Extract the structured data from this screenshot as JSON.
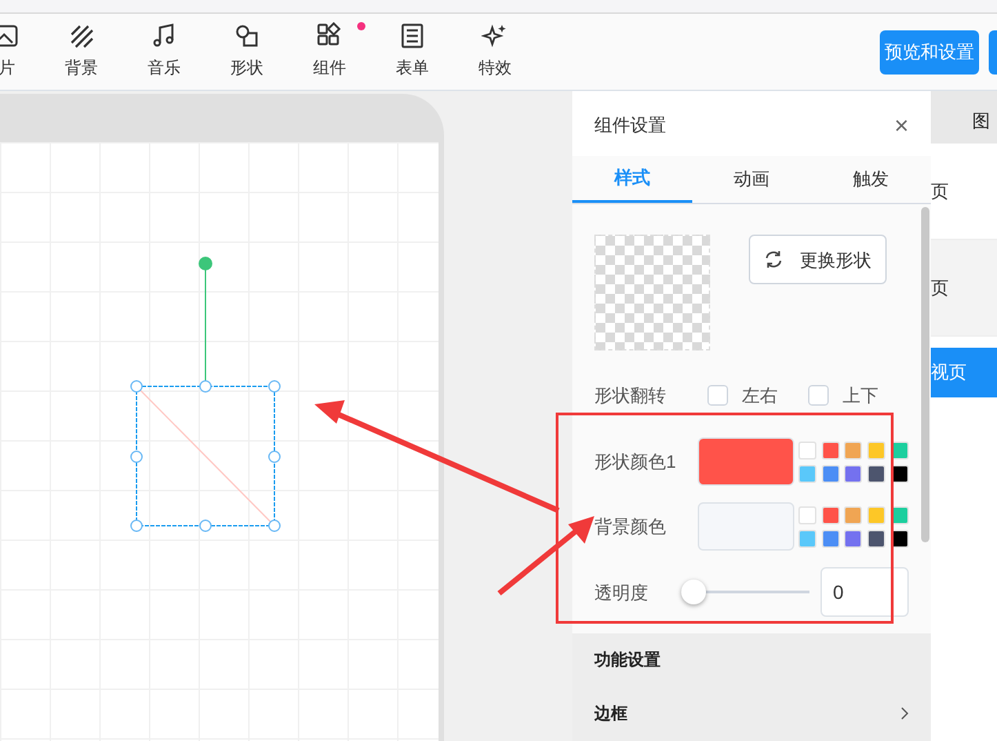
{
  "toolbar": {
    "tools": [
      {
        "label": "片",
        "badge": false
      },
      {
        "label": "背景",
        "badge": false
      },
      {
        "label": "音乐",
        "badge": false
      },
      {
        "label": "形状",
        "badge": false
      },
      {
        "label": "组件",
        "badge": true
      },
      {
        "label": "表单",
        "badge": false
      },
      {
        "label": "特效",
        "badge": false
      }
    ],
    "preview_button": "预览和设置"
  },
  "right_sidebar": {
    "header": "图",
    "items": [
      {
        "label": "页",
        "selected": false
      },
      {
        "label": "页",
        "selected": false
      },
      {
        "label": "视页",
        "selected": true
      }
    ]
  },
  "panel": {
    "title": "组件设置",
    "close": "×",
    "tabs": [
      {
        "label": "样式",
        "selected": true
      },
      {
        "label": "动画",
        "selected": false
      },
      {
        "label": "触发",
        "selected": false
      }
    ],
    "change_shape_button": "更换形状",
    "flip": {
      "label": "形状翻转",
      "options": [
        {
          "label": "左右",
          "checked": false
        },
        {
          "label": "上下",
          "checked": false
        }
      ]
    },
    "color_rows": [
      {
        "label": "形状颜色1",
        "color": "#ff534a"
      },
      {
        "label": "背景颜色",
        "color": "#f5f7fa"
      }
    ],
    "swatches": [
      {
        "color": "#ffffff"
      },
      {
        "color": "#ff5349"
      },
      {
        "color": "#f0a553"
      },
      {
        "color": "#fdc727"
      },
      {
        "color": "#1ccf9e"
      },
      {
        "color": "#5ac8fa"
      },
      {
        "color": "#4c8ef5"
      },
      {
        "color": "#7471ef"
      },
      {
        "color": "#4d556e"
      },
      {
        "color": "#000000"
      }
    ],
    "opacity": {
      "label": "透明度",
      "level": 0,
      "value": "0"
    },
    "sections": [
      {
        "label": "功能设置",
        "chevron": false
      },
      {
        "label": "边框",
        "chevron": true
      }
    ]
  }
}
